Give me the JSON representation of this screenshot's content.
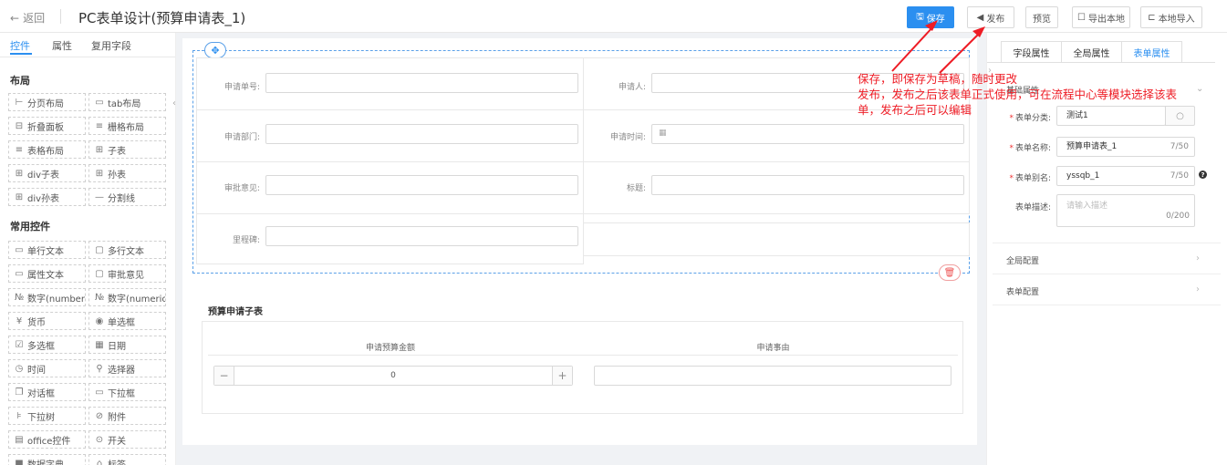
{
  "topbar": {
    "back_label": "返回",
    "title": "PC表单设计(预算申请表_1)",
    "buttons": {
      "save": "保存",
      "publish": "发布",
      "preview": "预览",
      "export": "导出本地",
      "import": "本地导入"
    }
  },
  "left_panel": {
    "tabs": [
      "控件",
      "属性",
      "复用字段"
    ],
    "layout_title": "布局",
    "layout_items": [
      {
        "label": "分页布局",
        "icon": "pagination-icon"
      },
      {
        "label": "tab布局",
        "icon": "tab-icon"
      },
      {
        "label": "折叠面板",
        "icon": "collapse-icon"
      },
      {
        "label": "栅格布局",
        "icon": "grid-icon"
      },
      {
        "label": "表格布局",
        "icon": "table-layout-icon"
      },
      {
        "label": "子表",
        "icon": "subtable-icon"
      },
      {
        "label": "div子表",
        "icon": "div-subtable-icon"
      },
      {
        "label": "孙表",
        "icon": "grandchild-table-icon"
      },
      {
        "label": "div孙表",
        "icon": "div-grandchild-table-icon"
      },
      {
        "label": "分割线",
        "icon": "divider-icon"
      }
    ],
    "common_title": "常用控件",
    "common_items": [
      {
        "label": "单行文本",
        "icon": "single-line-text-icon"
      },
      {
        "label": "多行文本",
        "icon": "multi-line-text-icon"
      },
      {
        "label": "属性文本",
        "icon": "attribute-text-icon"
      },
      {
        "label": "审批意见",
        "icon": "approval-opinion-icon"
      },
      {
        "label": "数字(number)",
        "icon": "number-icon"
      },
      {
        "label": "数字(numeric)",
        "icon": "numeric-icon"
      },
      {
        "label": "货币",
        "icon": "currency-icon"
      },
      {
        "label": "单选框",
        "icon": "radio-icon"
      },
      {
        "label": "多选框",
        "icon": "checkbox-icon"
      },
      {
        "label": "日期",
        "icon": "date-icon"
      },
      {
        "label": "时间",
        "icon": "time-icon"
      },
      {
        "label": "选择器",
        "icon": "selector-icon"
      },
      {
        "label": "对话框",
        "icon": "dialog-icon"
      },
      {
        "label": "下拉框",
        "icon": "dropdown-icon"
      },
      {
        "label": "下拉树",
        "icon": "dropdown-tree-icon"
      },
      {
        "label": "附件",
        "icon": "attachment-icon"
      },
      {
        "label": "office控件",
        "icon": "office-icon"
      },
      {
        "label": "开关",
        "icon": "switch-icon"
      },
      {
        "label": "数据字典",
        "icon": "data-dictionary-icon"
      },
      {
        "label": "标签",
        "icon": "tag-icon"
      }
    ]
  },
  "form": {
    "fields": {
      "apply_no": "申请单号:",
      "applicant": "申请人:",
      "department": "申请部门:",
      "apply_time": "申请时间:",
      "opinion": "审批意见:",
      "subject": "标题:",
      "milestone": "里程碑:"
    },
    "subtable": {
      "title": "预算申请子表",
      "col_amount": "申请预算金额",
      "col_reason": "申请事由",
      "amount_value": "0"
    }
  },
  "right_panel": {
    "tabs": [
      "字段属性",
      "全局属性",
      "表单属性"
    ],
    "basic_title": "基础属性",
    "category_label": "表单分类:",
    "category_value": "测试1",
    "name_label": "表单名称:",
    "name_value": "预算申请表_1",
    "name_count": "7/50",
    "alias_label": "表单别名:",
    "alias_value": "yssqb_1",
    "alias_count": "7/50",
    "desc_label": "表单描述:",
    "desc_placeholder": "请输入描述",
    "desc_count": "0/200",
    "global_config": "全局配置",
    "form_config": "表单配置"
  },
  "annotation": {
    "line1": "保存，即保存为草稿，随时更改",
    "line2": "发布，发布之后该表单正式使用，可在流程中心等模块选择该表",
    "line3": "单，发布之后可以编辑"
  },
  "colors": {
    "primary": "#2b8ff0",
    "annotation": "#ee1c25",
    "required": "#e33"
  }
}
